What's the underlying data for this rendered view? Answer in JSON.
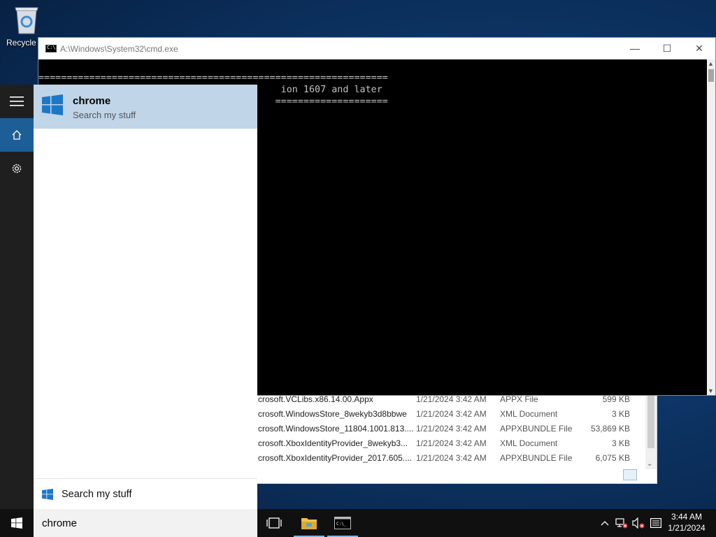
{
  "desktop": {
    "recycle_bin_label": "Recycle"
  },
  "cmd_window": {
    "title": "A:\\Windows\\System32\\cmd.exe",
    "console_lines": [
      "==============================================================",
      "                                           ion 1607 and later",
      "                                          ===================="
    ]
  },
  "explorer": {
    "rows": [
      {
        "name": "crosoft.VCLibs.x86.14.00.Appx",
        "date": "1/21/2024 3:42 AM",
        "type": "APPX File",
        "size": "599 KB"
      },
      {
        "name": "crosoft.WindowsStore_8wekyb3d8bbwe",
        "date": "1/21/2024 3:42 AM",
        "type": "XML Document",
        "size": "3 KB"
      },
      {
        "name": "crosoft.WindowsStore_11804.1001.813....",
        "date": "1/21/2024 3:42 AM",
        "type": "APPXBUNDLE File",
        "size": "53,869 KB"
      },
      {
        "name": "crosoft.XboxIdentityProvider_8wekyb3...",
        "date": "1/21/2024 3:42 AM",
        "type": "XML Document",
        "size": "3 KB"
      },
      {
        "name": "crosoft.XboxIdentityProvider_2017.605....",
        "date": "1/21/2024 3:42 AM",
        "type": "APPXBUNDLE File",
        "size": "6,075 KB"
      }
    ]
  },
  "search_panel": {
    "top_result": {
      "title": "chrome",
      "subtitle": "Search my stuff"
    },
    "footer_label": "Search my stuff"
  },
  "taskbar": {
    "search_value": "chrome",
    "clock_time": "3:44 AM",
    "clock_date": "1/21/2024"
  },
  "colors": {
    "accent": "#1e5e97",
    "selection": "#c0d5e8",
    "taskbar": "#101010"
  },
  "icons": [
    "recycle-bin-icon",
    "hamburger-icon",
    "home-icon",
    "gear-icon",
    "windows-logo-icon",
    "task-view-icon",
    "file-explorer-icon",
    "cmd-icon",
    "chevron-up-icon",
    "network-icon",
    "volume-icon",
    "notifications-icon"
  ]
}
